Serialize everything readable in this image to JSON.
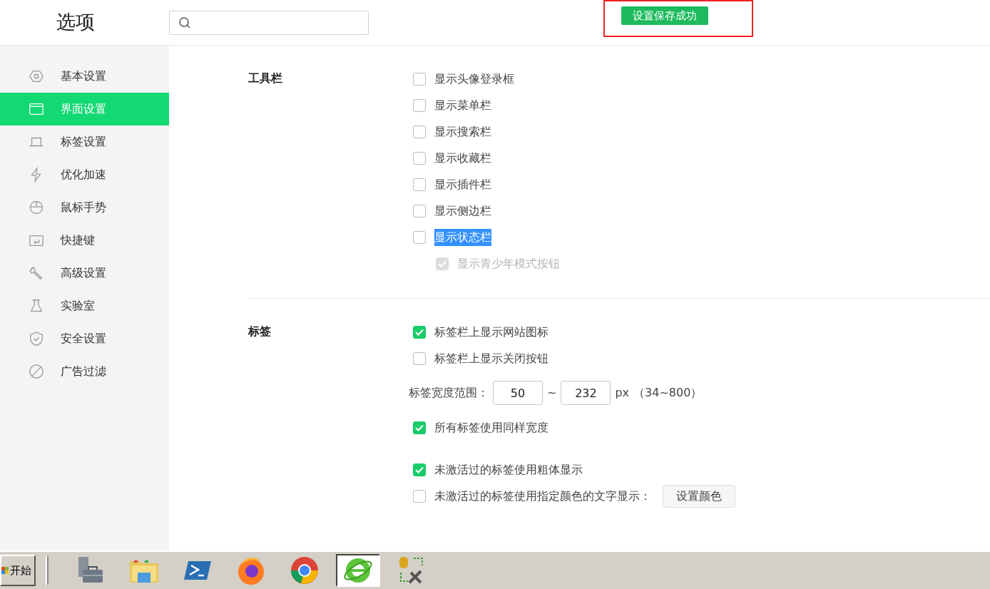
{
  "header": {
    "title": "选项",
    "toast": "设置保存成功"
  },
  "sidebar": {
    "items": [
      {
        "label": "基本设置",
        "selected": false
      },
      {
        "label": "界面设置",
        "selected": true
      },
      {
        "label": "标签设置",
        "selected": false
      },
      {
        "label": "优化加速",
        "selected": false
      },
      {
        "label": "鼠标手势",
        "selected": false
      },
      {
        "label": "快捷键",
        "selected": false
      },
      {
        "label": "高级设置",
        "selected": false
      },
      {
        "label": "实验室",
        "selected": false
      },
      {
        "label": "安全设置",
        "selected": false
      },
      {
        "label": "广告过滤",
        "selected": false
      }
    ]
  },
  "sections": [
    {
      "title": "工具栏",
      "groups": [
        [
          {
            "kind": "checkbox",
            "label": "显示头像登录框",
            "checked": false,
            "highlighted": false,
            "disabled": false
          },
          {
            "kind": "checkbox",
            "label": "显示菜单栏",
            "checked": false,
            "highlighted": false,
            "disabled": false
          },
          {
            "kind": "checkbox",
            "label": "显示搜索栏",
            "checked": false,
            "highlighted": false,
            "disabled": false
          },
          {
            "kind": "checkbox",
            "label": "显示收藏栏",
            "checked": false,
            "highlighted": false,
            "disabled": false
          },
          {
            "kind": "checkbox",
            "label": "显示插件栏",
            "checked": false,
            "highlighted": false,
            "disabled": false
          },
          {
            "kind": "checkbox",
            "label": "显示侧边栏",
            "checked": false,
            "highlighted": false,
            "disabled": false
          },
          {
            "kind": "checkbox",
            "label": "显示状态栏",
            "checked": false,
            "highlighted": true,
            "disabled": false,
            "children": [
              {
                "kind": "checkbox",
                "label": "显示青少年模式按钮",
                "checked": true,
                "highlighted": false,
                "disabled": true
              }
            ]
          }
        ]
      ]
    },
    {
      "title": "标签",
      "groups": [
        [
          {
            "kind": "checkbox",
            "label": "标签栏上显示网站图标",
            "checked": true,
            "highlighted": false,
            "disabled": false
          },
          {
            "kind": "checkbox",
            "label": "标签栏上显示关闭按钮",
            "checked": false,
            "highlighted": false,
            "disabled": false
          },
          {
            "kind": "range",
            "label": "标签宽度范围：",
            "min": "50",
            "separator": "~",
            "max": "232",
            "unit": "px",
            "hint": "（34~800）"
          },
          {
            "kind": "checkbox",
            "label": "所有标签使用同样宽度",
            "checked": true,
            "highlighted": false,
            "disabled": false
          }
        ],
        [
          {
            "kind": "checkbox",
            "label": "未激活过的标签使用粗体显示",
            "checked": true,
            "highlighted": false,
            "disabled": false
          },
          {
            "kind": "checkbox",
            "label": "未激活过的标签使用指定颜色的文字显示：",
            "checked": false,
            "highlighted": false,
            "disabled": false,
            "button": "设置颜色"
          }
        ]
      ]
    }
  ],
  "taskbar": {
    "start": "开始",
    "apps": [
      {
        "kind": "toolbox",
        "selected": false
      },
      {
        "kind": "folder",
        "selected": false
      },
      {
        "kind": "terminal",
        "selected": false
      },
      {
        "kind": "flame",
        "selected": false
      },
      {
        "kind": "ring",
        "selected": false
      },
      {
        "kind": "globe",
        "selected": true
      },
      {
        "kind": "tools",
        "selected": false
      }
    ]
  }
}
